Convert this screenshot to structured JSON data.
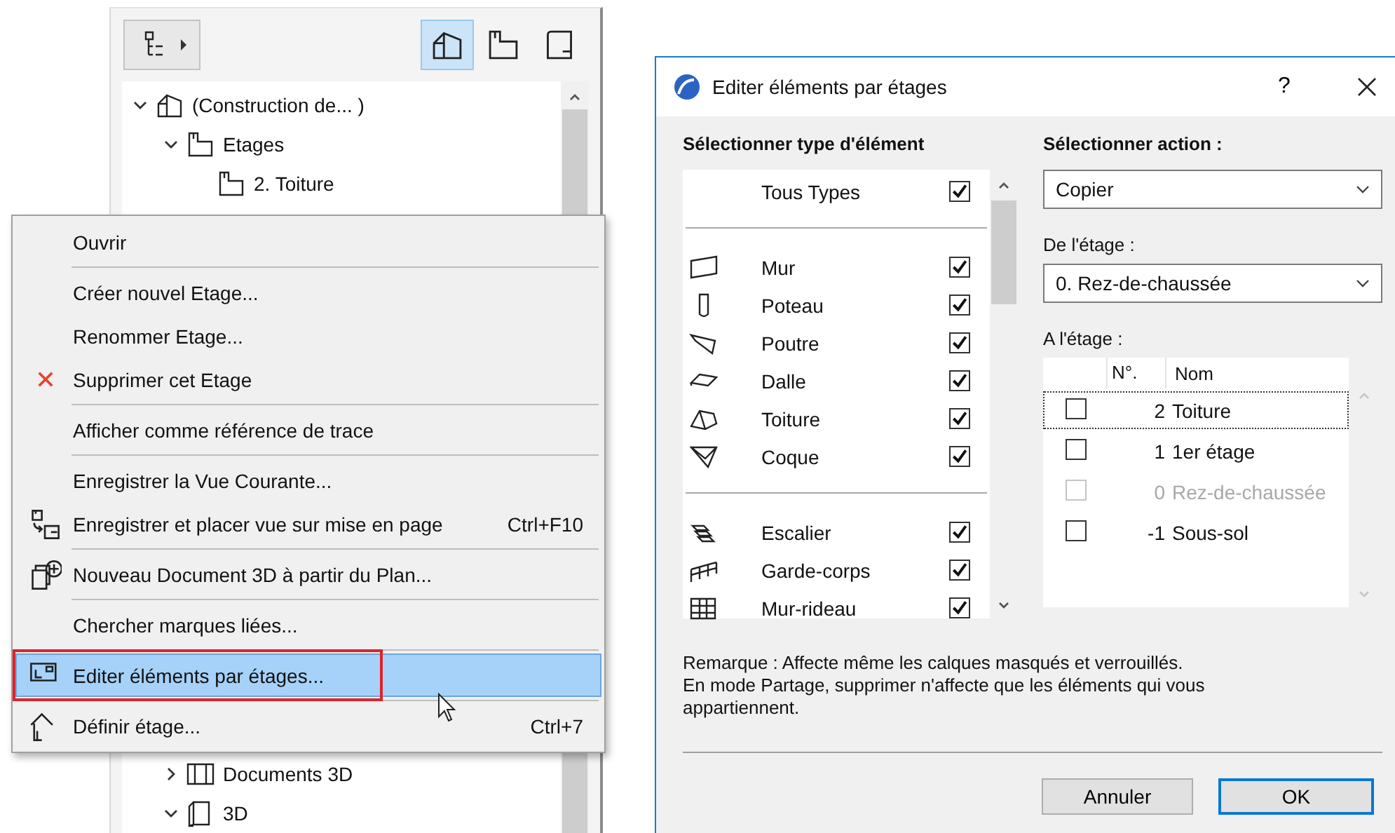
{
  "navigator": {
    "toolbar": {
      "menu_button": {
        "kind": "tree"
      },
      "view_buttons": [
        {
          "kind": "house",
          "selected": true
        },
        {
          "kind": "floor",
          "selected": false
        },
        {
          "kind": "section",
          "selected": false
        }
      ]
    },
    "tree_top": [
      {
        "label": "(Construction de... )",
        "kind": "house",
        "expanded": true,
        "children": [
          {
            "label": "Etages",
            "kind": "floor",
            "expanded": true,
            "children": [
              {
                "label": "2. Toiture",
                "kind": "floor"
              }
            ]
          }
        ]
      }
    ],
    "tree_bottom": [
      {
        "label": "Documents 3D",
        "kind": "doc3d",
        "expanded": false
      },
      {
        "label": "3D",
        "kind": "cube",
        "expanded": true
      }
    ]
  },
  "context_menu": {
    "items": [
      {
        "kind": "plain",
        "label": "Ouvrir",
        "selected": false
      },
      {
        "kind": "separator"
      },
      {
        "kind": "plain",
        "label": "Créer nouvel Etage...",
        "selected": false
      },
      {
        "kind": "plain",
        "label": "Renommer Etage...",
        "selected": false
      },
      {
        "kind": "delete",
        "label": "Supprimer cet Etage",
        "selected": false
      },
      {
        "kind": "separator"
      },
      {
        "kind": "plain",
        "label": "Afficher comme référence de trace",
        "selected": false
      },
      {
        "kind": "separator"
      },
      {
        "kind": "plain",
        "label": "Enregistrer la Vue Courante...",
        "selected": false
      },
      {
        "kind": "save-place",
        "label": "Enregistrer et placer vue sur mise en page",
        "shortcut": "Ctrl+F10",
        "selected": false
      },
      {
        "kind": "separator"
      },
      {
        "kind": "new-3d",
        "label": "Nouveau Document 3D à partir du Plan...",
        "selected": false
      },
      {
        "kind": "separator"
      },
      {
        "kind": "plain",
        "label": "Chercher marques liées...",
        "selected": false
      },
      {
        "kind": "separator"
      },
      {
        "kind": "edit-stories",
        "label": "Editer éléments par étages...",
        "selected": true,
        "outlined": true
      },
      {
        "kind": "separator"
      },
      {
        "kind": "define-story",
        "label": "Définir étage...",
        "shortcut": "Ctrl+7",
        "selected": false
      }
    ]
  },
  "dialog": {
    "title": "Editer éléments par étages",
    "help": "?",
    "types": {
      "heading": "Sélectionner type d'élément",
      "items": [
        {
          "kind": "all",
          "label": "Tous Types",
          "checked": true
        },
        {
          "kind": "separator"
        },
        {
          "kind": "wall",
          "label": "Mur",
          "checked": true
        },
        {
          "kind": "column",
          "label": "Poteau",
          "checked": true
        },
        {
          "kind": "beam",
          "label": "Poutre",
          "checked": true
        },
        {
          "kind": "slab",
          "label": "Dalle",
          "checked": true
        },
        {
          "kind": "roof",
          "label": "Toiture",
          "checked": true
        },
        {
          "kind": "shell",
          "label": "Coque",
          "checked": true
        },
        {
          "kind": "separator"
        },
        {
          "kind": "stair",
          "label": "Escalier",
          "checked": true
        },
        {
          "kind": "railing",
          "label": "Garde-corps",
          "checked": true
        },
        {
          "kind": "curtain",
          "label": "Mur-rideau",
          "checked": true
        }
      ]
    },
    "action": {
      "heading": "Sélectionner action :",
      "value": "Copier"
    },
    "from_story": {
      "label": "De l'étage :",
      "value": "0. Rez-de-chaussée"
    },
    "to_story": {
      "label": "A l'étage :",
      "columns": [
        "N°.",
        "Nom"
      ],
      "rows": [
        {
          "number": "2",
          "name": "Toiture",
          "checked": false,
          "disabled": false,
          "focused": true
        },
        {
          "number": "1",
          "name": "1er étage",
          "checked": false,
          "disabled": false,
          "focused": false
        },
        {
          "number": "0",
          "name": "Rez-de-chaussée",
          "checked": false,
          "disabled": true,
          "focused": false
        },
        {
          "number": "-1",
          "name": "Sous-sol",
          "checked": false,
          "disabled": false,
          "focused": false
        }
      ]
    },
    "remarks": [
      "Remarque : Affecte même les calques masqués et verrouillés.",
      "En mode Partage, supprimer n'affecte que les éléments qui vous appartiennent."
    ],
    "buttons": [
      {
        "label": "Annuler",
        "default": false
      },
      {
        "label": "OK",
        "default": true
      }
    ]
  }
}
